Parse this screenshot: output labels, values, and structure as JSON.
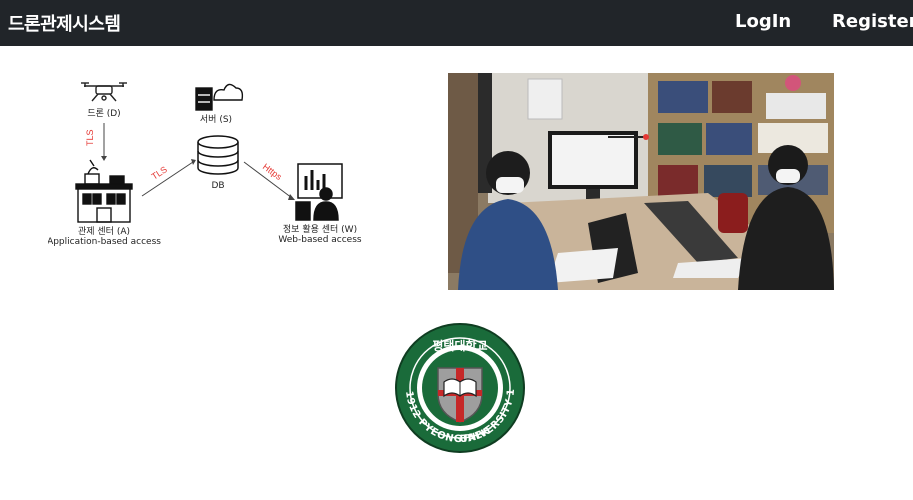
{
  "navbar": {
    "brand": "드론관제시스템",
    "login_label": "LogIn",
    "register_label": "Register"
  },
  "diagram": {
    "drone_label": "드론 (D)",
    "server_label": "서버 (S)",
    "db_label": "DB",
    "control_center_label": "관제 센터 (A)",
    "control_center_sub": "Application-based access",
    "info_center_label": "정보 활용 센터 (W)",
    "info_center_sub": "Web-based access",
    "tls_drone_db": "TLS",
    "tls_center_db": "TLS",
    "https_label": "Https"
  },
  "emblem": {
    "top_text": "평택대학교",
    "ring_text_left": "1912 PYEONGTAEK",
    "ring_text_right": "UNIVERSITY 1981"
  },
  "colors": {
    "navbar_bg": "#212529",
    "emblem_green": "#1a6b3a",
    "emblem_red": "#c62828"
  }
}
